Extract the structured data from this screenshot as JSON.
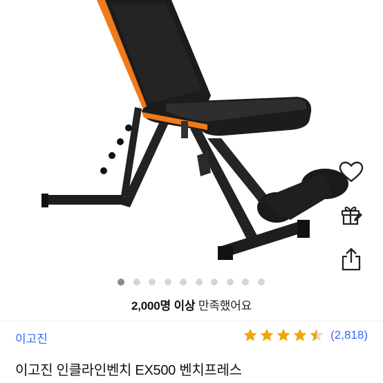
{
  "product": {
    "image_alt": "incline bench photo",
    "title": "이고진 인클라인벤치 EX500 벤치프레스",
    "brand": "이고진"
  },
  "carousel": {
    "total_dots": 10,
    "active_index": 0
  },
  "satisfaction": {
    "count_text": "2,000명 이상",
    "suffix_text": " 만족했어요"
  },
  "rating": {
    "value": 4.5,
    "max": 5,
    "review_count_text": "(2,818)"
  },
  "actions": {
    "icons": [
      "heart-icon",
      "gift-icon",
      "share-icon"
    ]
  },
  "colors": {
    "star": "#f2a600",
    "link": "#346aff",
    "accent_orange": "#f07a1a"
  }
}
